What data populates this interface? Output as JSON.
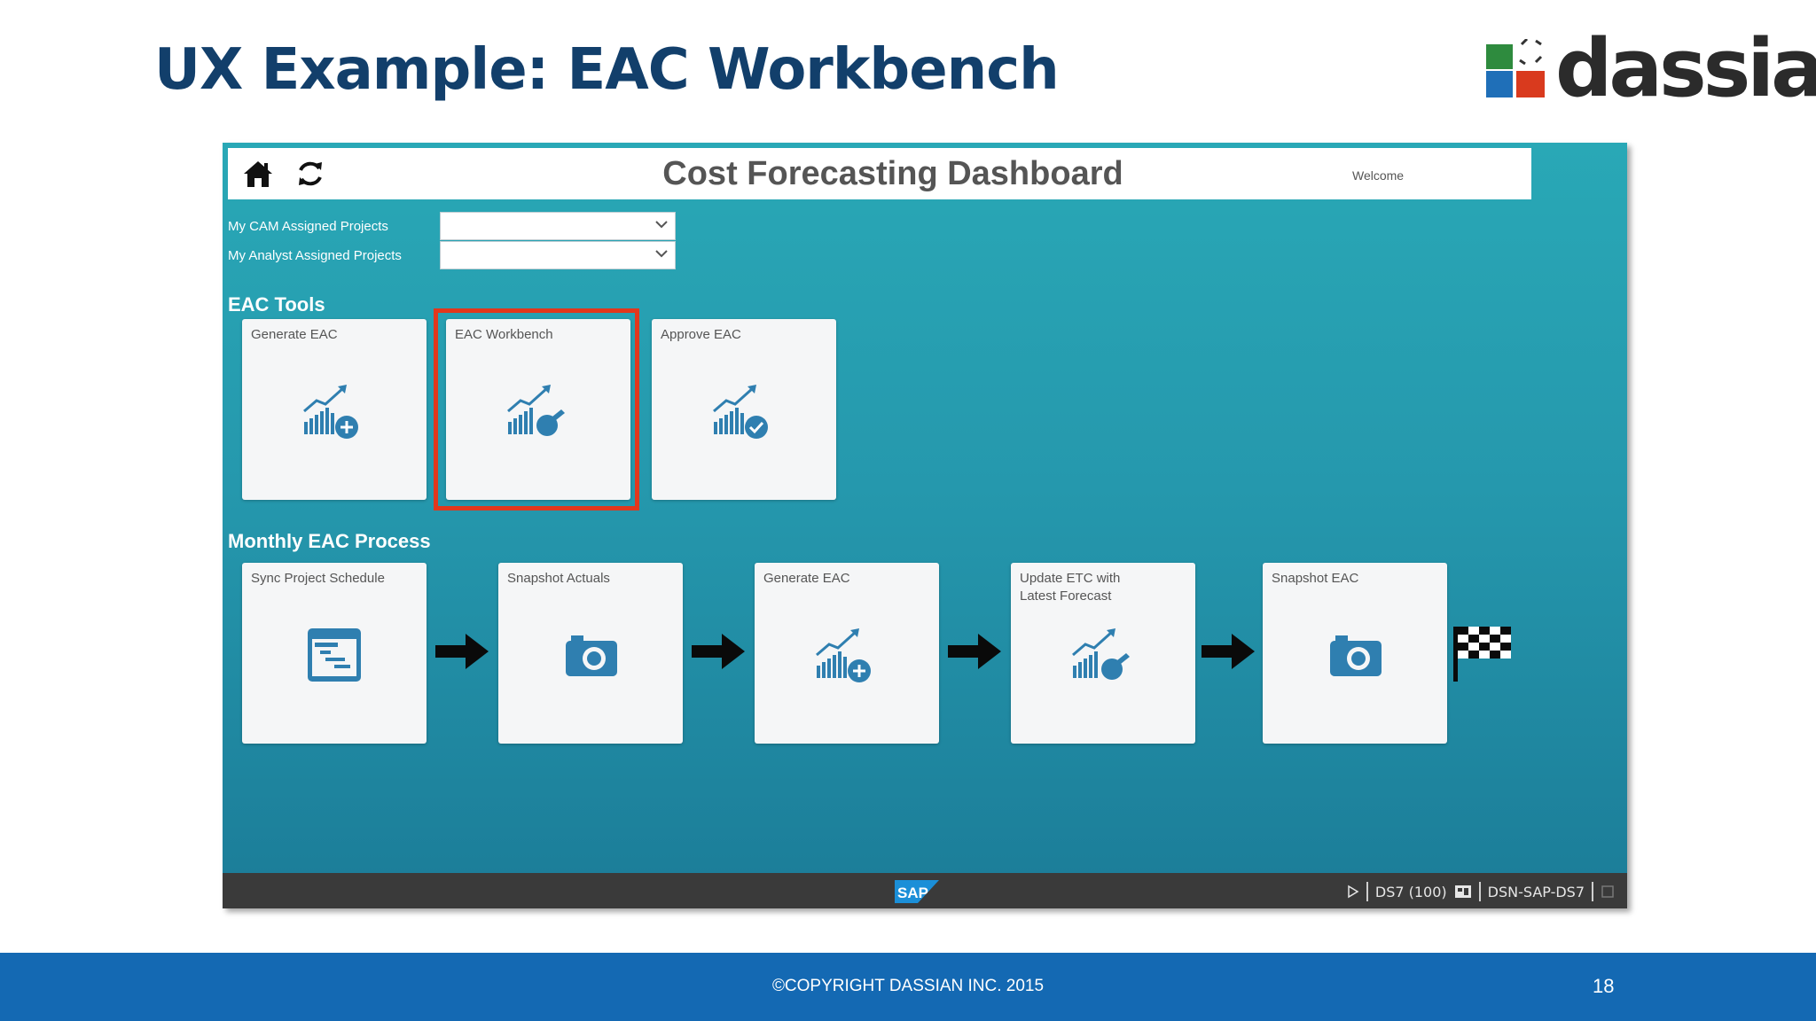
{
  "slide": {
    "title": "UX Example: EAC Workbench",
    "logo_text": "dassian",
    "footer_text": "©COPYRIGHT DASSIAN INC. 2015",
    "page_number": "18"
  },
  "app": {
    "title": "Cost Forecasting Dashboard",
    "welcome": "Welcome",
    "filters": [
      {
        "label": "My CAM Assigned Projects",
        "value": ""
      },
      {
        "label": "My Analyst Assigned Projects",
        "value": ""
      }
    ],
    "eac_tools": {
      "heading": "EAC Tools",
      "tiles": [
        {
          "label": "Generate EAC",
          "icon": "chart-plus-icon"
        },
        {
          "label": "EAC Workbench",
          "icon": "chart-wrench-icon",
          "highlighted": true
        },
        {
          "label": "Approve EAC",
          "icon": "chart-check-icon"
        }
      ]
    },
    "monthly_process": {
      "heading": "Monthly EAC Process",
      "tiles": [
        {
          "label": "Sync Project Schedule",
          "icon": "gantt-icon"
        },
        {
          "label": "Snapshot Actuals",
          "icon": "camera-icon"
        },
        {
          "label": "Generate EAC",
          "icon": "chart-plus-icon"
        },
        {
          "label": "Update ETC with Latest Forecast",
          "icon": "chart-wrench-icon"
        },
        {
          "label": "Snapshot EAC",
          "icon": "camera-icon"
        }
      ],
      "end_icon": "checkered-flag-icon"
    },
    "status_bar": {
      "sap_logo": "SAP",
      "system": "DS7 (100)",
      "server": "DSN-SAP-DS7"
    }
  },
  "colors": {
    "title": "#123f6b",
    "teal_top": "#29a8b6",
    "teal_bottom": "#1b7c98",
    "icon_blue": "#2f7fb0",
    "highlight": "#e2371c",
    "footer": "#1469b3"
  }
}
